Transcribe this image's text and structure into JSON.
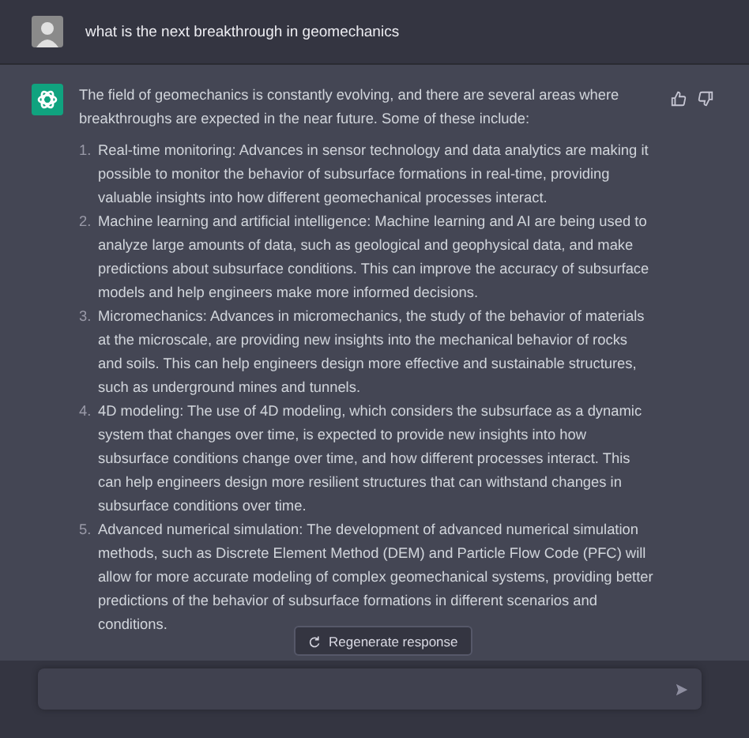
{
  "user_message": {
    "text": "what is the next breakthrough in geomechanics"
  },
  "assistant_message": {
    "intro": "The field of geomechanics is constantly evolving, and there are several areas where breakthroughs are expected in the near future. Some of these include:",
    "items": [
      {
        "number": "1.",
        "text": "Real-time monitoring: Advances in sensor technology and data analytics are making it possible to monitor the behavior of subsurface formations in real-time, providing valuable insights into how different geomechanical processes interact."
      },
      {
        "number": "2.",
        "text": "Machine learning and artificial intelligence: Machine learning and AI are being used to analyze large amounts of data, such as geological and geophysical data, and make predictions about subsurface conditions. This can improve the accuracy of subsurface models and help engineers make more informed decisions."
      },
      {
        "number": "3.",
        "text": "Micromechanics: Advances in micromechanics, the study of the behavior of materials at the microscale, are providing new insights into the mechanical behavior of rocks and soils. This can help engineers design more effective and sustainable structures, such as underground mines and tunnels."
      },
      {
        "number": "4.",
        "text": "4D modeling: The use of 4D modeling, which considers the subsurface as a dynamic system that changes over time, is expected to provide new insights into how subsurface conditions change over time, and how different processes interact. This can help engineers design more resilient structures that can withstand changes in subsurface conditions over time."
      },
      {
        "number": "5.",
        "text": "Advanced numerical simulation: The development of advanced numerical simulation methods, such as Discrete Element Method (DEM) and Particle Flow Code (PFC) will allow for more accurate modeling of complex geomechanical systems, providing better predictions of the behavior of subsurface formations in different scenarios and conditions."
      }
    ]
  },
  "regenerate_button": {
    "label": "Regenerate response"
  }
}
